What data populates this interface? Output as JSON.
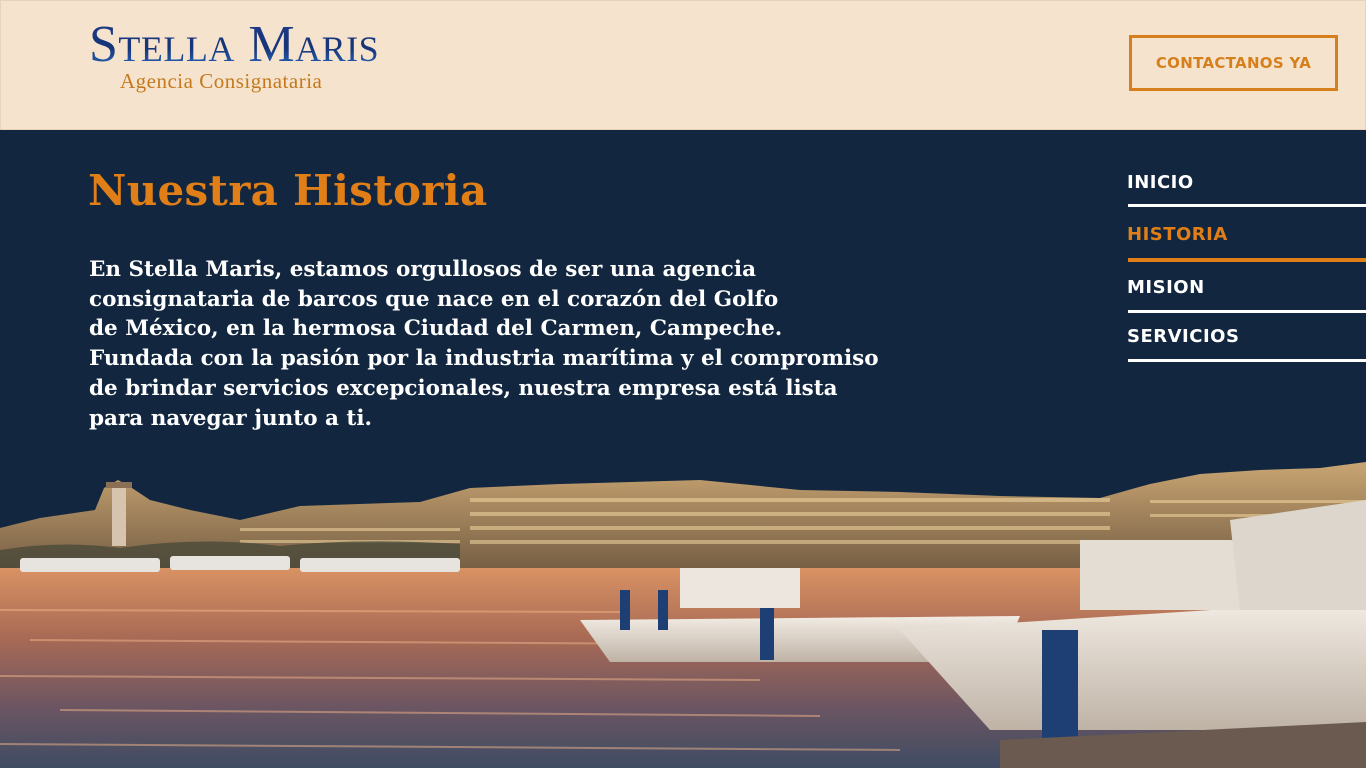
{
  "header": {
    "logo_title": "Stella Maris",
    "logo_subtitle": "Agencia Consignataria",
    "contact_button": "CONTACTANOS YA"
  },
  "main": {
    "title": "Nuestra Historia",
    "paragraph_lines": [
      "En Stella Maris, estamos orgullosos de ser una agencia",
      "consignataria de barcos que nace en el corazón del Golfo",
      "de México, en la hermosa Ciudad del Carmen, Campeche.",
      "Fundada con la pasión por la industria marítima y el compromiso",
      "de brindar servicios excepcionales, nuestra empresa está lista",
      "para navegar junto a ti."
    ]
  },
  "nav": {
    "items": [
      {
        "label": "INICIO",
        "active": false
      },
      {
        "label": "HISTORIA",
        "active": true
      },
      {
        "label": "MISION",
        "active": false
      },
      {
        "label": "SERVICIOS",
        "active": false
      }
    ]
  },
  "colors": {
    "accent": "#e07e17",
    "header_bg": "#f6e3cd",
    "page_bg": "#12273f",
    "text": "#ffffff"
  }
}
